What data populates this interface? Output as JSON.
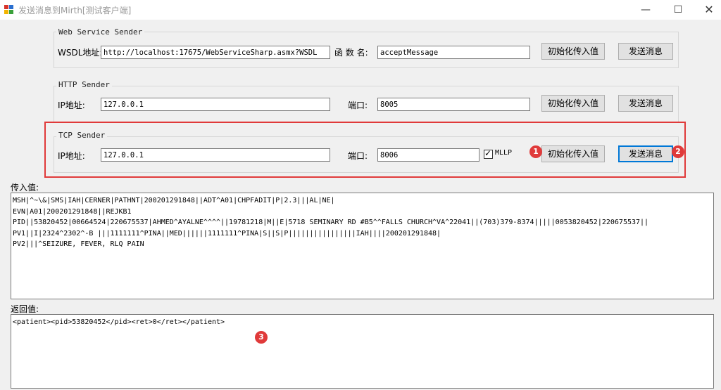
{
  "window": {
    "title": "发送消息到Mirth[测试客户端]"
  },
  "web_service": {
    "group_title": "Web  Service Sender",
    "wsdl_label": "WSDL地址:",
    "wsdl_value": "http://localhost:17675/WebServiceSharp.asmx?WSDL",
    "function_label": "函 数 名:",
    "function_value": "acceptMessage",
    "init_button": "初始化传入值",
    "send_button": "发送消息"
  },
  "http": {
    "group_title": "HTTP Sender",
    "ip_label": "IP地址:",
    "ip_value": "127.0.0.1",
    "port_label": "端口:",
    "port_value": "8005",
    "init_button": "初始化传入值",
    "send_button": "发送消息"
  },
  "tcp": {
    "group_title": "TCP Sender",
    "ip_label": "IP地址:",
    "ip_value": "127.0.0.1",
    "port_label": "端口:",
    "port_value": "8006",
    "mllp_label": "MLLP",
    "mllp_checked": true,
    "init_button": "初始化传入值",
    "send_button": "发送消息"
  },
  "input": {
    "label": "传入值:",
    "lines": [
      "MSH|^~\\&|SMS|IAH|CERNER|PATHNT|200201291848||ADT^A01|CHPFADIT|P|2.3|||AL|NE|",
      "EVN|A01|200201291848||REJKB1",
      "PID||53820452|00664524|220675537|AHMED^AYALNE^^^^||19781218|M||E|5718 SEMINARY RD #B5^^FALLS CHURCH^VA^22041||(703)379-8374|||||0053820452|220675537||",
      "PV1||I|2324^2302^-B |||1111111^PINA||MED||||||1111111^PINA|S||S|P||||||||||||||||IAH||||200201291848|",
      "PV2|||^SEIZURE, FEVER, RLQ PAIN"
    ]
  },
  "output": {
    "label": "返回值:",
    "value": "<patient><pid>53820452</pid><ret>0</ret></patient>"
  },
  "annotations": {
    "m1": "1",
    "m2": "2",
    "m3": "3",
    "color": "#e03a3a"
  },
  "icons": {
    "minimize": "minimize-icon",
    "maximize": "maximize-icon",
    "close": "close-icon",
    "check": "✓"
  }
}
